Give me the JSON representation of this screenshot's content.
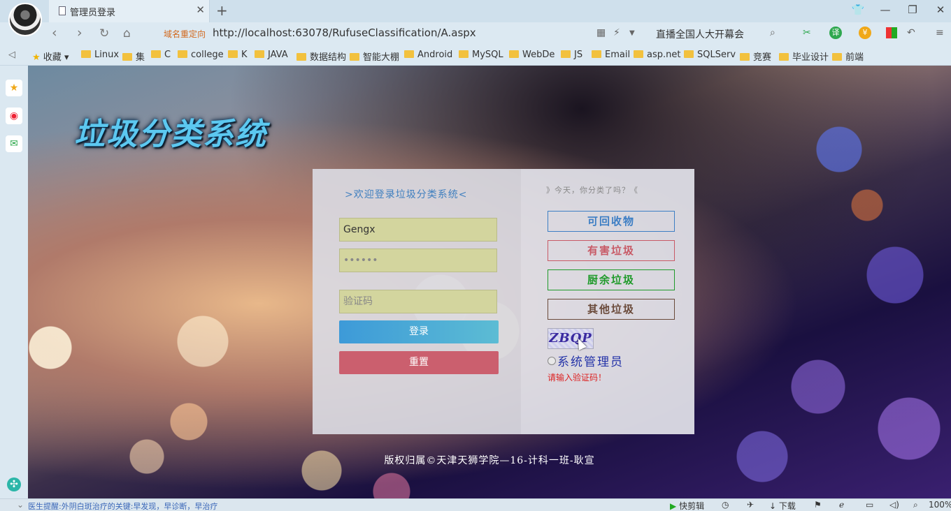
{
  "browser": {
    "tab_title": "管理员登录",
    "redirect_label": "域名重定向",
    "url": "http://localhost:63078/RufuseClassification/A.aspx",
    "news": "直播全国人大开幕会",
    "translate_label": "译"
  },
  "bookmarks": [
    "收藏",
    "Linux",
    "集",
    "C",
    "college",
    "K",
    "JAVA",
    "数据结构",
    "智能大棚",
    "Android",
    "MySQL",
    "WebDe",
    "JS",
    "Email",
    "asp.net",
    "SQLServ",
    "竞赛",
    "毕业设计",
    "前端"
  ],
  "page": {
    "logo": "垃圾分类系统",
    "welcome": ">欢迎登录垃圾分类系统<",
    "username_value": "Gengx",
    "password_value": "••••••",
    "captcha_placeholder": "验证码",
    "login_label": "登录",
    "reset_label": "重置",
    "today_text": "》今天，你分类了吗？《",
    "categories": [
      {
        "label": "可回收物",
        "color": "#3d7ec4"
      },
      {
        "label": "有害垃圾",
        "color": "#c85a66"
      },
      {
        "label": "厨余垃圾",
        "color": "#1f9a2a"
      },
      {
        "label": "其他垃圾",
        "color": "#6a4a3a"
      }
    ],
    "captcha_text": "ZBQP",
    "admin_radio_label": "系统管理员",
    "error_text": "请输入验证码！",
    "copyright": "版权归属©天津天狮学院—16-计科一班-耿宣"
  },
  "status": {
    "message": "医生提醒:外阴白斑治疗的关键:早发现，早诊断，早治疗",
    "quick_edit": "快剪辑",
    "download": "下载",
    "zoom": "100%"
  }
}
